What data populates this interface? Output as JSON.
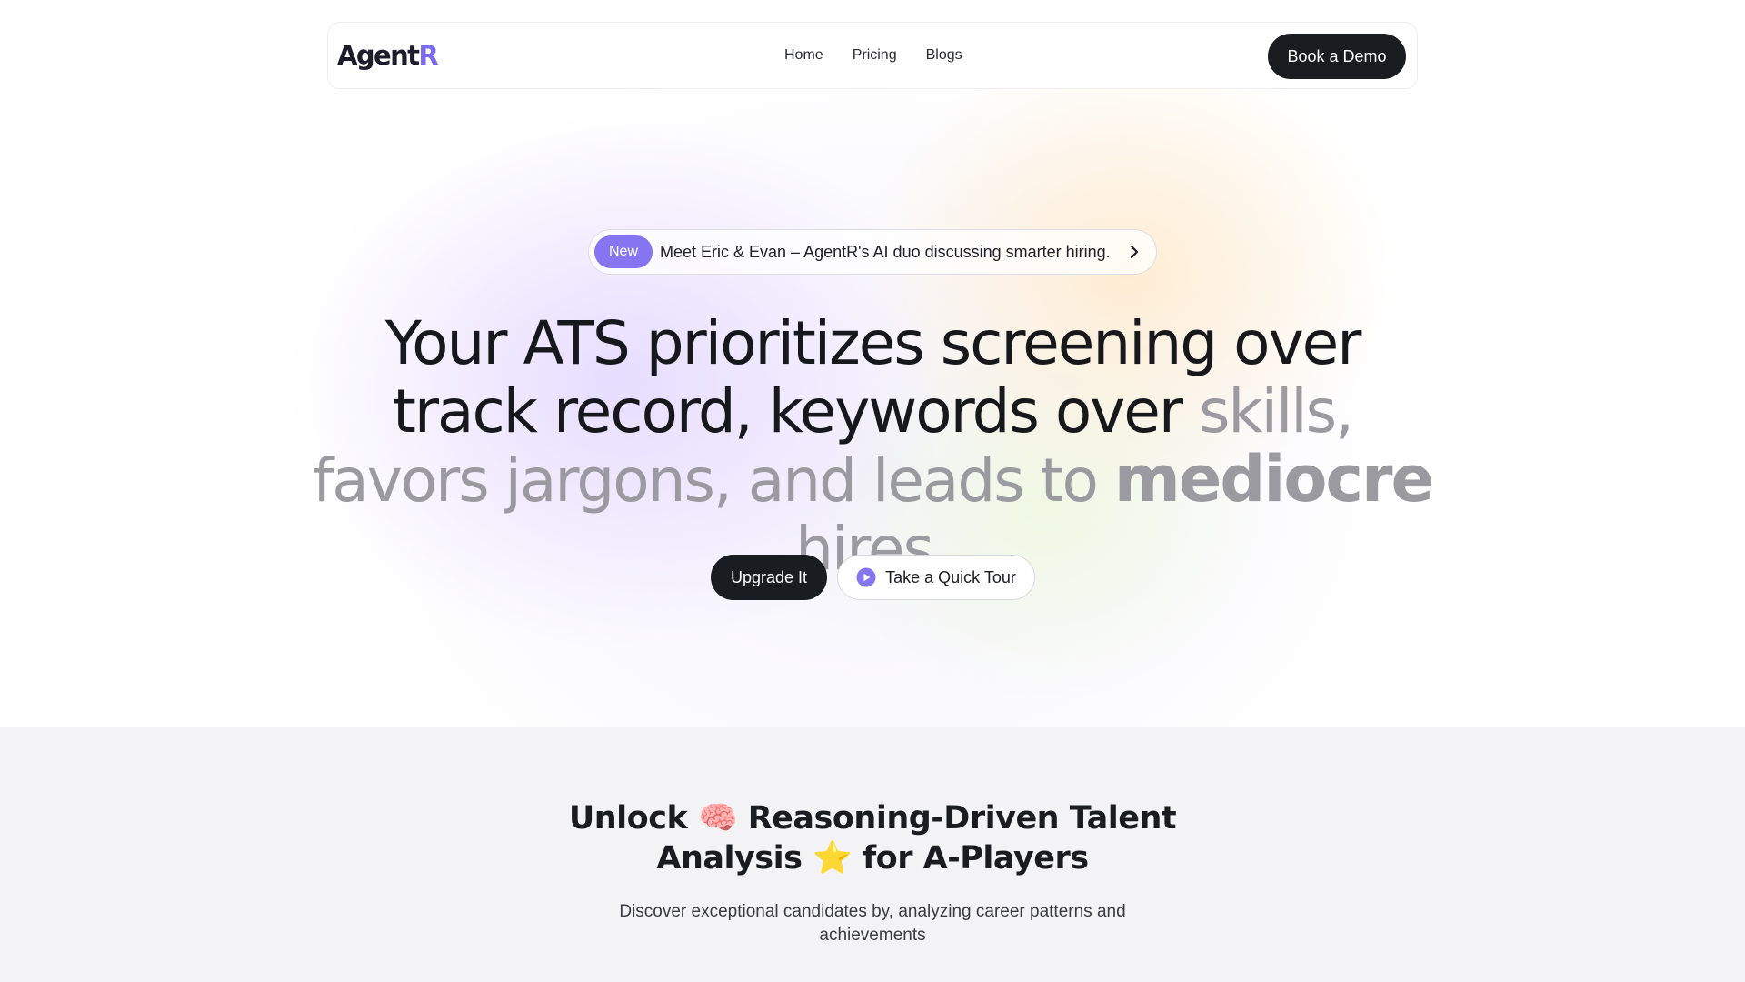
{
  "nav": {
    "logo_main": "Agent",
    "logo_accent": "R",
    "links": [
      "Home",
      "Pricing",
      "Blogs"
    ],
    "cta_label": "Book a Demo"
  },
  "announcement": {
    "badge": "New",
    "text": "Meet Eric & Evan – AgentR's AI duo discussing smarter hiring.",
    "icon": "chevron-right-icon"
  },
  "hero": {
    "headline_dark": "Your ATS prioritizes screening over track record, keywords over ",
    "headline_muted_1": "skills, favors jargons, and leads to ",
    "headline_emphasis": "mediocre",
    "headline_muted_2": " hires.",
    "primary_cta": "Upgrade It",
    "secondary_cta": "Take a Quick Tour",
    "secondary_icon": "play-icon"
  },
  "section2": {
    "title_part1": "Unlock ",
    "title_emoji1": "🧠",
    "title_part2": " Reasoning-Driven Talent Analysis ",
    "title_emoji2": "⭐",
    "title_part3": " for A-Players",
    "subtitle": "Discover exceptional candidates by, analyzing career patterns and achievements"
  },
  "colors": {
    "accent": "#7b6cf0",
    "badge": "#8575f0",
    "dark_button": "#1a1c21",
    "muted_text": "#9a9aa0",
    "section_bg": "#f3f3f6"
  }
}
